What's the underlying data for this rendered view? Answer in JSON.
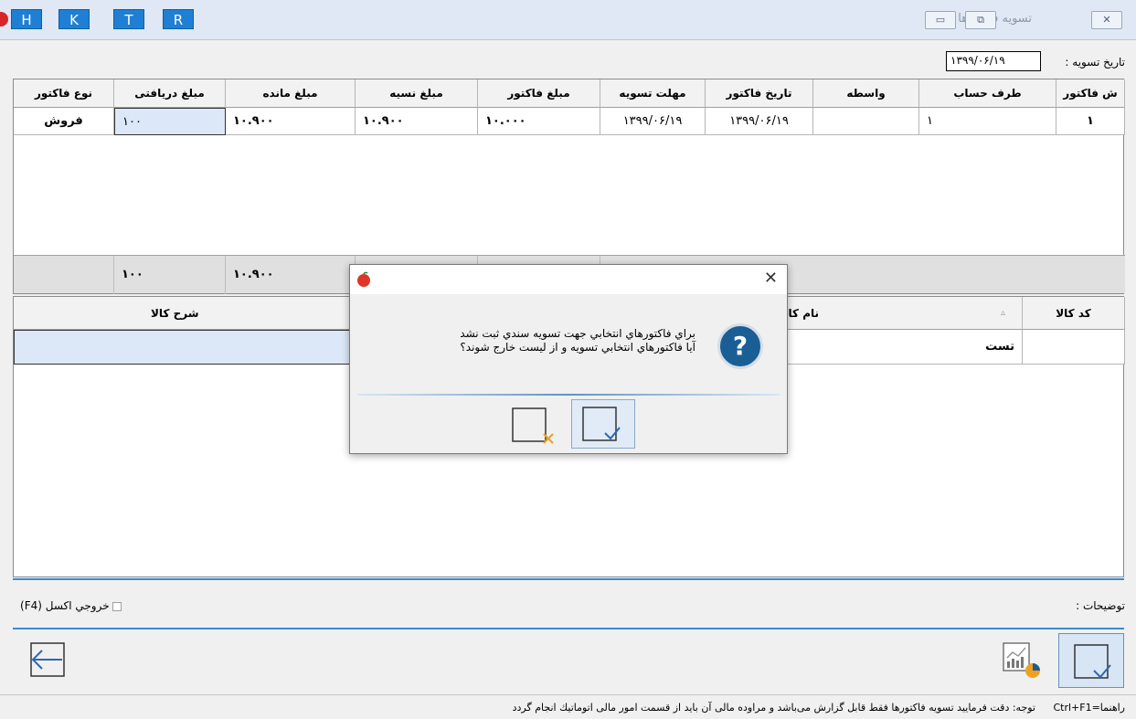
{
  "toolbar": {
    "hk_buttons": [
      "H",
      "K",
      "T",
      "R"
    ]
  },
  "window": {
    "title": "تسویه فاکتورها",
    "close_glyph": "✕",
    "restore_glyph": "⧉",
    "minimize_glyph": "▭"
  },
  "settle_date": {
    "label": "تاریخ تسویه :",
    "value": "۱۳۹۹/۰۶/۱۹"
  },
  "invoices": {
    "columns": [
      "ش فاکتور",
      "طرف حساب",
      "واسطه",
      "تاریخ فاکتور",
      "مهلت تسویه",
      "مبلغ فاکتور",
      "مبلغ نسیه",
      "مبلغ مانده",
      "مبلغ دریافتی",
      "نوع فاکتور"
    ],
    "rows": [
      [
        "۱",
        "۱",
        "",
        "۱۳۹۹/۰۶/۱۹",
        "۱۳۹۹/۰۶/۱۹",
        "۱۰.۰۰۰",
        "۱۰.۹۰۰",
        "۱۰.۹۰۰",
        "۱۰۰",
        "فروش"
      ]
    ],
    "totals": {
      "received": "۱۰۰",
      "remaining": "۱۰.۹۰۰"
    }
  },
  "goods": {
    "columns": [
      "کد کالا",
      "نام کالا",
      "شرح کالا"
    ],
    "rows": [
      [
        "",
        "تست",
        ""
      ]
    ]
  },
  "notes_label": "توضیحات :",
  "excel_label": "خروجي اكسل (F4)",
  "status_bar": {
    "hint": "راهنما=Ctrl+F1",
    "message": "توجه: دقت فرمایید تسویه فاکتورها فقط قابل گزارش می‌باشد و مراوده مالی آن باید از قسمت امور مالی اتوماتیك انجام گردد"
  },
  "dialog": {
    "close_glyph": "✕",
    "question_glyph": "?",
    "line1": "براي فاكتورهاي انتخابي جهت تسويه سندي ثبت نشد",
    "line2": "آيا فاكتورهاي انتخابي تسويه و از ليست خارج شوند؟"
  },
  "colors": {
    "accent": "#1f7fd4",
    "selected_cell": "#dce8f7",
    "dialog_icon": "#1a5e96"
  }
}
